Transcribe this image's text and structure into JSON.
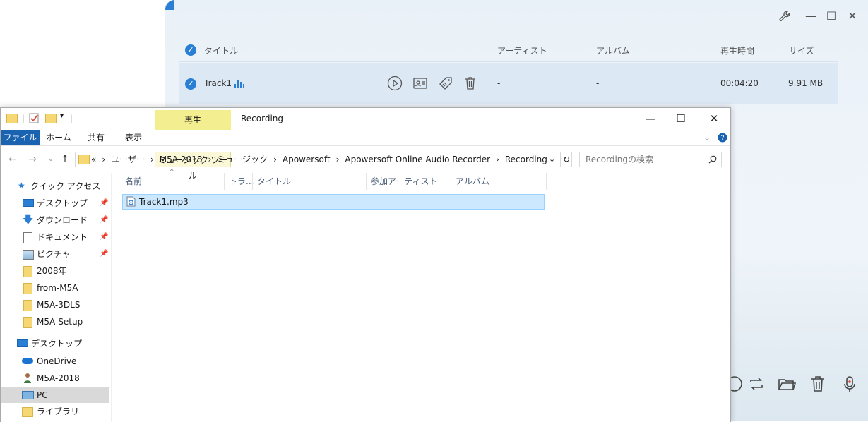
{
  "recorder": {
    "window_controls": {
      "wrench": "wrench-icon",
      "minimize": "—",
      "maximize": "☐",
      "close": "✕"
    },
    "columns": {
      "title": "タイトル",
      "artist": "アーティスト",
      "album": "アルバム",
      "duration": "再生時間",
      "size": "サイズ"
    },
    "track": {
      "title": "Track1",
      "artist": "-",
      "album": "-",
      "duration": "00:04:20",
      "size": "9.91 MB"
    }
  },
  "explorer": {
    "context_tab": "再生",
    "context_subtab": "ミュージック ツール",
    "window_title": "Recording",
    "ribbon_tabs": [
      "ファイル",
      "ホーム",
      "共有",
      "表示"
    ],
    "breadcrumb": [
      "«",
      "ユーザー",
      "M5A-2018",
      "ミュージック",
      "Apowersoft",
      "Apowersoft Online Audio Recorder",
      "Recording"
    ],
    "breadcrumb_sep": "›",
    "search_placeholder": "Recordingの検索",
    "nav": {
      "quick_access": "クイック アクセス",
      "pinned": [
        "デスクトップ",
        "ダウンロード",
        "ドキュメント",
        "ピクチャ"
      ],
      "folders": [
        "2008年",
        "from-M5A",
        "M5A-3DLS",
        "M5A-Setup"
      ],
      "desktop": "デスクトップ",
      "onedrive": "OneDrive",
      "user": "M5A-2018",
      "pc": "PC",
      "library": "ライブラリ"
    },
    "columns": {
      "name": "名前",
      "track": "トラ...",
      "title": "タイトル",
      "artists": "参加アーティスト",
      "album": "アルバム"
    },
    "files": [
      "Track1.mp3"
    ]
  },
  "colors": {
    "accent": "#2a7fd4",
    "file_tab": "#1a63b0",
    "context_tab": "#f3ee90",
    "selection": "#cce8ff"
  }
}
